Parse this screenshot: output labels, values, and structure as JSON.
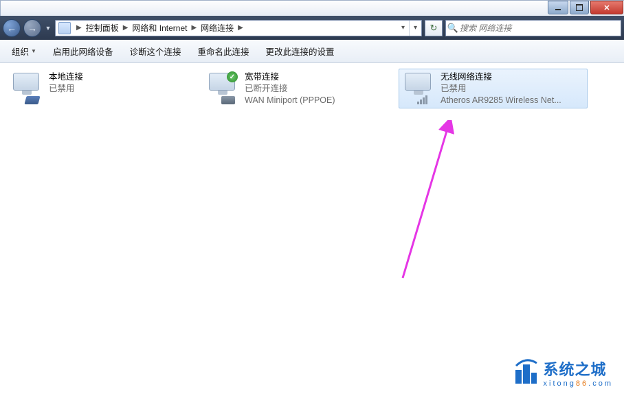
{
  "breadcrumb": {
    "segments": [
      "控制面板",
      "网络和 Internet",
      "网络连接"
    ]
  },
  "search": {
    "placeholder": "搜索 网络连接"
  },
  "toolbar": {
    "organize": "组织",
    "enable_device": "启用此网络设备",
    "diagnose": "诊断这个连接",
    "rename": "重命名此连接",
    "change_settings": "更改此连接的设置"
  },
  "connections": [
    {
      "title": "本地连接",
      "status": "已禁用",
      "detail": "",
      "icon_type": "plug",
      "overlay": "",
      "selected": false
    },
    {
      "title": "宽带连接",
      "status": "已断开连接",
      "detail": "WAN Miniport (PPPOE)",
      "icon_type": "modem",
      "overlay": "ok",
      "selected": false
    },
    {
      "title": "无线网络连接",
      "status": "已禁用",
      "detail": "Atheros AR9285 Wireless Net...",
      "icon_type": "signal",
      "overlay": "",
      "selected": true
    }
  ],
  "watermark": {
    "title": "系统之城",
    "url_parts": [
      "x",
      "i",
      "t",
      "o",
      "n",
      "g",
      "8",
      "6",
      ".",
      "c",
      "o",
      "m"
    ]
  }
}
